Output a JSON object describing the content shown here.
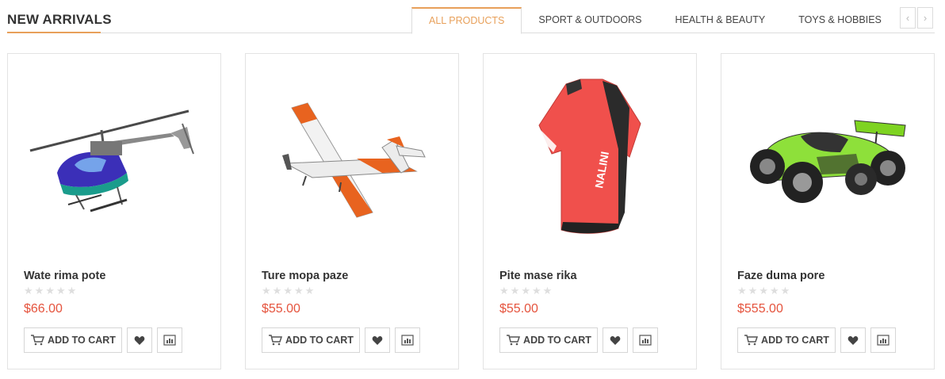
{
  "section": {
    "title": "NEW ARRIVALS"
  },
  "tabs": [
    {
      "label": "ALL PRODUCTS",
      "active": true
    },
    {
      "label": "SPORT & OUTDOORS",
      "active": false
    },
    {
      "label": "HEALTH & BEAUTY",
      "active": false
    },
    {
      "label": "TOYS & HOBBIES",
      "active": false
    }
  ],
  "nav": {
    "prev_icon": "chevron-left-icon",
    "next_icon": "chevron-right-icon",
    "prev_glyph": "‹",
    "next_glyph": "›"
  },
  "products": [
    {
      "name": "Wate rima pote",
      "price": "$66.00",
      "rating": 0,
      "image": "helicopter-image",
      "cart_label": "ADD TO CART"
    },
    {
      "name": "Ture mopa paze",
      "price": "$55.00",
      "rating": 0,
      "image": "airplane-image",
      "cart_label": "ADD TO CART"
    },
    {
      "name": "Pite mase rika",
      "price": "$55.00",
      "rating": 0,
      "image": "cycling-jersey-image",
      "cart_label": "ADD TO CART"
    },
    {
      "name": "Faze duma pore",
      "price": "$555.00",
      "rating": 0,
      "image": "rc-car-image",
      "cart_label": "ADD TO CART"
    }
  ],
  "colors": {
    "accent": "#e8a05a",
    "price": "#e5533d",
    "star_empty": "#dedede",
    "border": "#dcdcdc"
  }
}
